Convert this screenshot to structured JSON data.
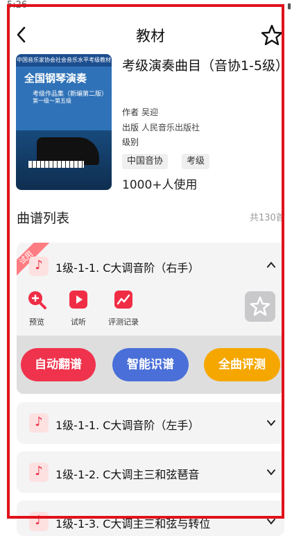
{
  "status": {
    "time": "5:26"
  },
  "header": {
    "title": "教材"
  },
  "book": {
    "title": "考级演奏曲目（音协1-5级）",
    "author_label": "作者",
    "author": "吴迎",
    "publisher_label": "出版",
    "publisher": "人民音乐出版社",
    "level_label": "级别",
    "tags": [
      "中国音协",
      "考级"
    ],
    "users": "1000+人使用",
    "cover": {
      "top_line": "中国音乐家协会社会音乐水平考级教材",
      "heading": "全国钢琴演奏",
      "sub1": "考级作品集（新编第二版）",
      "sub2": "第一级～第五级"
    }
  },
  "list": {
    "title": "曲谱列表",
    "count": "共130首",
    "expanded": {
      "badge": "试用",
      "title": "1级-1-1. C大调音阶（右手）",
      "actions": [
        "预览",
        "试听",
        "评测记录"
      ],
      "buttons": [
        {
          "label": "自动翻谱",
          "color": "#f0334d"
        },
        {
          "label": "智能识谱",
          "color": "#4a6fd8"
        },
        {
          "label": "全曲评测",
          "color": "#f5a700"
        }
      ]
    },
    "items": [
      {
        "title": "1级-1-1. C大调音阶（左手）"
      },
      {
        "title": "1级-1-2. C大调主三和弦琶音"
      },
      {
        "title": "1级-1-3. C大调主三和弦与转位"
      }
    ]
  },
  "colors": {
    "accent_red": "#e0121b",
    "icon_red": "#ef2e45"
  }
}
